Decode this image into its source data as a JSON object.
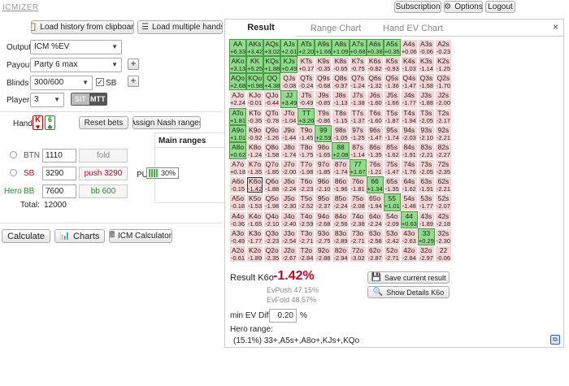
{
  "app": {
    "logo": "ICMIZER"
  },
  "topbar": {
    "subscription": "Subscription",
    "options": "Options",
    "logout": "Logout"
  },
  "left": {
    "load_clipboard": "Load history from clipboard",
    "load_multiple": "Load multiple hands o",
    "output_label": "Output",
    "output_value": "ICM %EV",
    "payout_label": "Payout",
    "payout_value": "Party 6 max",
    "blinds_label": "Blinds",
    "blinds_value": "300/600",
    "sb_label": "SB",
    "players_label": "Players",
    "players_value": "3",
    "toggle_sit": "SIT",
    "toggle_mtt": "MTT",
    "hand_label": "Hand",
    "card1": {
      "rank": "K",
      "suit": "♥"
    },
    "card2": {
      "rank": "6",
      "suit": "♣"
    },
    "reset_bets": "Reset bets",
    "assign_nash": "Assign Nash ranges",
    "players": [
      {
        "pos": "BTN",
        "stack": "1110",
        "action": "fold"
      },
      {
        "pos": "SB",
        "stack": "3290",
        "action": "push 3290"
      },
      {
        "pos": "BB",
        "hero": "Hero",
        "stack": "7600",
        "action": "bb 600"
      }
    ],
    "total_label": "Total:",
    "total_value": "12000",
    "main_ranges_title": "Main ranges",
    "pu_label": "PU",
    "pu_value": "30%",
    "calculate": "Calculate",
    "charts": "Charts",
    "icm_calc": "ICM Calculator"
  },
  "tabs": {
    "result": "Result",
    "range_chart": "Range Chart",
    "hand_ev_chart": "Hand EV Chart",
    "close": "×"
  },
  "result": {
    "label": "Result K6o",
    "value": "-1.42%",
    "ev_push": "EvPush 47.15%",
    "ev_fold": "EvFold 48.57%",
    "save": "Save current result",
    "show_details": "Show Details K6o",
    "min_ev_label": "min EV Diff",
    "min_ev_value": "0.20",
    "min_ev_unit": "%",
    "hero_range_label": "Hero range:",
    "hero_range_value": "(15.1%) 33+,A5s+,A8o+,KJs+,KQo"
  },
  "grid": [
    [
      "AA|+6.33|p",
      "AKs|+3.42|p",
      "AQs|+3.02|p",
      "AJs|+2.61|p",
      "ATs|+2.20|p",
      "A9s|+1.66|p",
      "A8s|+1.09|p",
      "A7s|+0.68|p",
      "A6s|+0.38|p",
      "A5s|+0.35|p",
      "A4s|+0.06|f",
      "A3s|-0.06|f",
      "A2s|-0.23|f"
    ],
    [
      "AKo|+3.13|p",
      "KK|+5.25|p",
      "KQs|+1.88|p",
      "KJs|+0.49|p",
      "KTs|+0.17|f",
      "K9s|-0.35|f",
      "K8s|-0.65|f",
      "K7s|-0.75|f",
      "K6s|-0.82|f",
      "K5s|-0.93|f",
      "K4s|-1.03|f",
      "K3s|-1.14|f",
      "K2s|-1.25|f"
    ],
    [
      "AQo|+2.68|p",
      "KQo|+0.98|p",
      "QQ|+4.38|p",
      "QJs|-0.08|f",
      "QTs|-0.24|f",
      "Q9s|-0.68|f",
      "Q8s|-0.97|f",
      "Q7s|-1.24|f",
      "Q6s|-1.32|f",
      "Q5s|-1.36|f",
      "Q4s|-1.47|f",
      "Q3s|-1.58|f",
      "Q2s|-1.70|f"
    ],
    [
      "AJo|+2.24|f",
      "KJo|-0.01|f",
      "QJo|-0.44|f",
      "JJ|+3.49|p",
      "JTs|-0.49|f",
      "J9s|-0.85|f",
      "J8s|-1.13|f",
      "J7s|-1.38|f",
      "J6s|-1.60|f",
      "J5s|-1.66|f",
      "J4s|-1.77|f",
      "J3s|-1.88|f",
      "J2s|-2.00|f"
    ],
    [
      "ATo|+1.81|p",
      "KTo|-0.35|f",
      "QTo|-0.78|f",
      "JTo|-1.04|f",
      "TT|+3.26|p",
      "T9s|-0.86|f",
      "T8s|-1.15|f",
      "T7s|-1.37|f",
      "T6s|-1.60|f",
      "T5s|-1.87|f",
      "T4s|-1.94|f",
      "T3s|-2.05|f",
      "T2s|-2.17|f"
    ],
    [
      "A9o|+1.01|p",
      "K9o|-0.92|f",
      "Q9o|-1.26|f",
      "J9o|-1.44|f",
      "T9o|-1.45|f",
      "99|+2.59|p",
      "98s|-1.05|f",
      "97s|-1.25|f",
      "96s|-1.47|f",
      "95s|-1.74|f",
      "94s|-2.03|f",
      "93s|-2.10|f",
      "92s|-2.21|f"
    ],
    [
      "A8o|+0.62|p",
      "K8o|-1.24|f",
      "Q8o|-1.58|f",
      "J8o|-1.74|f",
      "T8o|-1.75|f",
      "98o|-1.65|f",
      "88|+2.08|p",
      "87s|-1.14|f",
      "86s|-1.35|f",
      "85s|-1.62|f",
      "84s|-1.91|f",
      "83s|-2.21|f",
      "82s|-2.27|f"
    ],
    [
      "A7o|+0.18|f",
      "K7o|-1.35|f",
      "Q7o|-1.85|f",
      "J7o|-2.00|f",
      "T7o|-1.98|f",
      "97o|-1.85|f",
      "87o|-1.74|f",
      "77|+1.67|p",
      "76s|-1.21|f",
      "75s|-1.47|f",
      "74s|-1.76|f",
      "73s|-2.05|f",
      "72s|-2.35|f"
    ],
    [
      "A6o|-0.15|f",
      "K6o|-1.42|s",
      "Q6o|-1.88|f",
      "J6o|-2.24|f",
      "T6o|-2.23|f",
      "96o|-2.10|f",
      "86o|-1.96|f",
      "76o|-1.81|f",
      "66|+1.34|p",
      "65s|-1.35|f",
      "64s|-1.62|f",
      "63s|-1.91|f",
      "62s|-2.21|f"
    ],
    [
      "A5o|-0.18|f",
      "K5o|-1.53|f",
      "Q5o|-1.98|f",
      "J5o|-2.30|f",
      "T5o|-2.52|f",
      "95o|-2.37|f",
      "85o|-2.24|f",
      "75o|-2.08|f",
      "65o|-1.94|f",
      "55|+1.01|p",
      "54s|-1.48|f",
      "53s|-1.77|f",
      "52s|-2.07|f"
    ],
    [
      "A4o|-0.36|f",
      "K4o|-1.65|f",
      "Q4o|-2.10|f",
      "J4o|-2.40|f",
      "T4o|-2.59|f",
      "94o|-2.68|f",
      "84o|-2.56|f",
      "74o|-2.38|f",
      "64o|-2.24|f",
      "54o|-2.09|f",
      "44|+0.63|p",
      "43s|-1.89|f",
      "42s|-2.18|f"
    ],
    [
      "A3o|-0.49|f",
      "K3o|-1.77|f",
      "Q3o|-2.23|f",
      "J3o|-2.54|f",
      "T3o|-2.71|f",
      "93o|-2.75|f",
      "83o|-2.89|f",
      "73o|-2.71|f",
      "63o|-2.58|f",
      "53o|-2.42|f",
      "43o|-2.63|f",
      "33|+0.29|p",
      "32s|-2.30|f"
    ],
    [
      "A2o|-0.61|f",
      "K2o|-1.89|f",
      "Q2o|-2.35|f",
      "J2o|-2.67|f",
      "T2o|-2.84|f",
      "92o|-2.88|f",
      "82o|-2.94|f",
      "72o|-3.02|f",
      "62o|-2.87|f",
      "52o|-2.71|f",
      "42o|-2.84|f",
      "32o|-2.97|f",
      "22|-0.06|f"
    ]
  ],
  "colors": {
    "push": "#8fdc8a",
    "fold": "#f6d4d4",
    "negative": "#d0021b",
    "hero": "#2a8a2a"
  }
}
